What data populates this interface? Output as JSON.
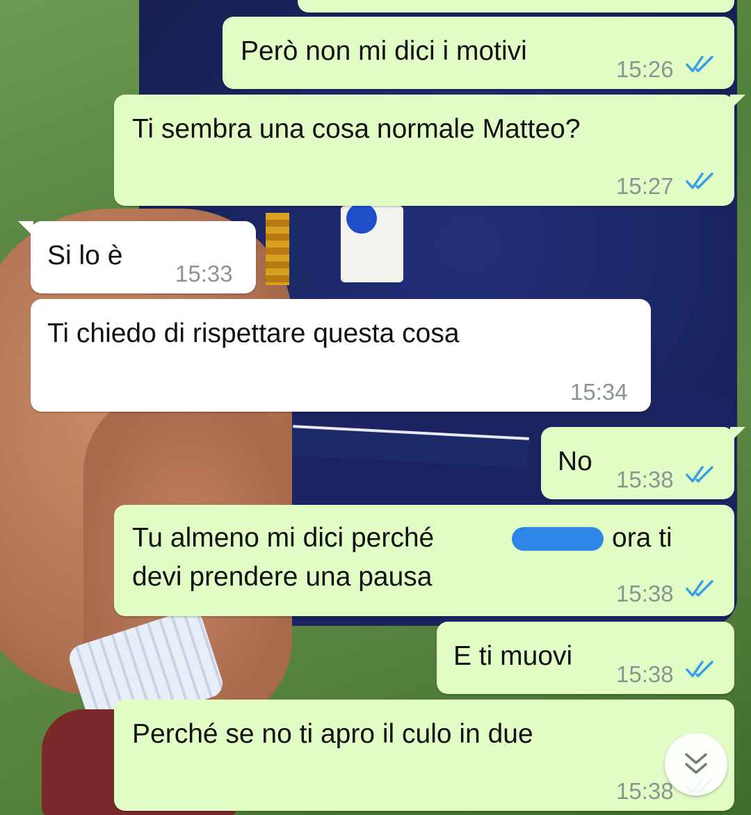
{
  "colors": {
    "outgoing_bubble": "#e2fcc6",
    "incoming_bubble": "#ffffff",
    "read_ticks": "#34a0e6",
    "timestamp": "#8a9590"
  },
  "messages": [
    {
      "direction": "outgoing",
      "text": "Però non mi dici i motivi",
      "time": "15:26",
      "status": "read"
    },
    {
      "direction": "outgoing",
      "text": "Ti sembra una cosa normale Matteo?",
      "time": "15:27",
      "status": "read"
    },
    {
      "direction": "incoming",
      "text": "Si lo è",
      "time": "15:33"
    },
    {
      "direction": "incoming",
      "text": "Ti chiedo di rispettare questa cosa",
      "time": "15:34"
    },
    {
      "direction": "outgoing",
      "text": "No",
      "time": "15:38",
      "status": "read"
    },
    {
      "direction": "outgoing",
      "text_line1_before": "Tu almeno mi dici perché",
      "text_line1_after": "ora ti",
      "text_line2": "devi prendere una pausa",
      "time": "15:38",
      "status": "read",
      "redacted": true
    },
    {
      "direction": "outgoing",
      "text": "E ti muovi",
      "time": "15:38",
      "status": "read"
    },
    {
      "direction": "outgoing",
      "text": "Perché se no ti apro il culo in due",
      "time": "15:38",
      "status": "read"
    }
  ],
  "scroll_button": {
    "icon": "double-chevron-down-icon"
  }
}
